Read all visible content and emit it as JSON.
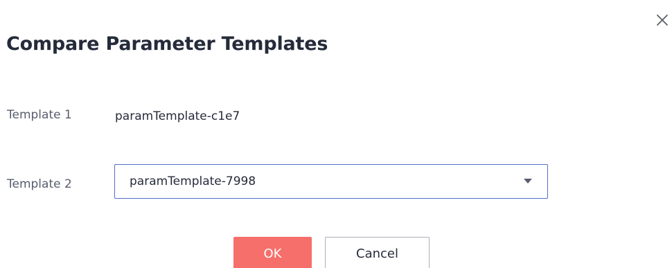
{
  "dialog": {
    "title": "Compare Parameter Templates",
    "close_icon": "close-icon"
  },
  "form": {
    "template1": {
      "label": "Template 1",
      "value": "paramTemplate-c1e7"
    },
    "template2": {
      "label": "Template 2",
      "selected": "paramTemplate-7998",
      "caret_icon": "caret-down-icon"
    }
  },
  "actions": {
    "ok_label": "OK",
    "cancel_label": "Cancel"
  },
  "colors": {
    "primary_button": "#f66f6a",
    "select_border": "#526ecc",
    "title_text": "#252b3a",
    "label_text": "#575d6c"
  }
}
